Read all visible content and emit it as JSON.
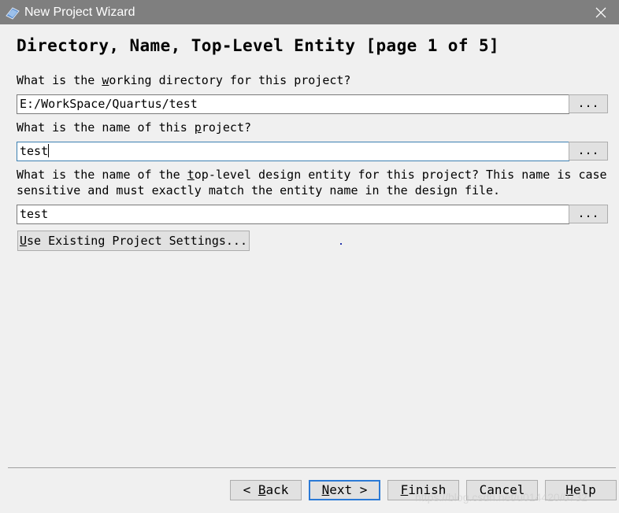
{
  "window": {
    "title": "New Project Wizard"
  },
  "heading": "Directory, Name, Top-Level Entity [page 1 of 5]",
  "directory": {
    "label_pre": "What is the ",
    "label_access": "w",
    "label_post": "orking directory for this project?",
    "value": "E:/WorkSpace/Quartus/test",
    "browse_label": "..."
  },
  "name": {
    "label_pre": "What is the name of this ",
    "label_access": "p",
    "label_post": "roject?",
    "value": "test",
    "browse_label": "..."
  },
  "entity": {
    "label_line1_pre": "What is the name of the ",
    "label_line1_access": "t",
    "label_line1_post": "op-level design entity for this project? This name is case",
    "label_line2": "sensitive and must exactly match the entity name in the design file.",
    "value": "test",
    "browse_label": "..."
  },
  "existing_settings": {
    "access": "U",
    "label": "se Existing Project Settings..."
  },
  "footer": {
    "back": {
      "pre": "< ",
      "access": "B",
      "post": "ack"
    },
    "next": {
      "pre": "",
      "access": "N",
      "post": "ext >"
    },
    "finish": {
      "pre": "",
      "access": "F",
      "post": "inish"
    },
    "cancel": {
      "label": "Cancel"
    },
    "help": {
      "pre": "",
      "access": "H",
      "post": "elp"
    }
  },
  "watermark": "https://blog.csdn.net/u014420/0732",
  "colors": {
    "titlebar": "#7f7f7f",
    "button_face": "#e1e1e1",
    "default_border": "#2b7ad6"
  }
}
